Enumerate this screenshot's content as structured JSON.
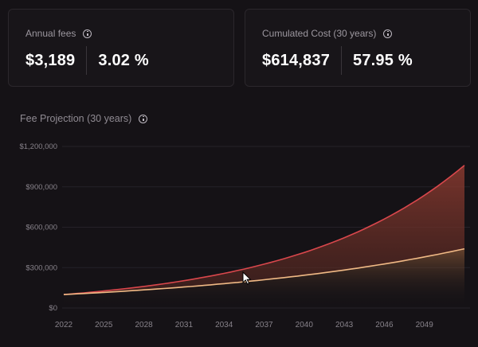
{
  "cards": [
    {
      "title": "Annual fees",
      "value": "$3,189",
      "percent": "3.02 %"
    },
    {
      "title": "Cumulated Cost (30 years)",
      "value": "$614,837",
      "percent": "57.95 %"
    }
  ],
  "chart_title": "Fee Projection (30 years)",
  "chart_data": {
    "type": "area",
    "title": "Fee Projection (30 years)",
    "xlabel": "",
    "ylabel": "",
    "x_ticks": [
      "2022",
      "2025",
      "2028",
      "2031",
      "2034",
      "2037",
      "2040",
      "2043",
      "2046",
      "2049"
    ],
    "y_ticks": [
      "$0",
      "$300,000",
      "$600,000",
      "$900,000",
      "$1,200,000"
    ],
    "ylim": [
      0,
      1200000
    ],
    "xlim": [
      2022,
      2052
    ],
    "grid": true,
    "colors": {
      "upper": "#d9474c",
      "lower": "#f0b985"
    },
    "series": [
      {
        "x": [
          2022,
          2025,
          2028,
          2031,
          2034,
          2037,
          2040,
          2043,
          2046,
          2049,
          2052
        ],
        "values": [
          100000,
          131000,
          171000,
          224000,
          294000,
          385000,
          506000,
          663000,
          870000,
          1140000,
          1060000
        ]
      },
      {
        "x": [
          2022,
          2025,
          2028,
          2031,
          2034,
          2037,
          2040,
          2043,
          2046,
          2049,
          2052
        ],
        "values": [
          100000,
          115000,
          132000,
          152000,
          175000,
          202000,
          234000,
          271000,
          315000,
          366000,
          440000
        ]
      }
    ]
  }
}
